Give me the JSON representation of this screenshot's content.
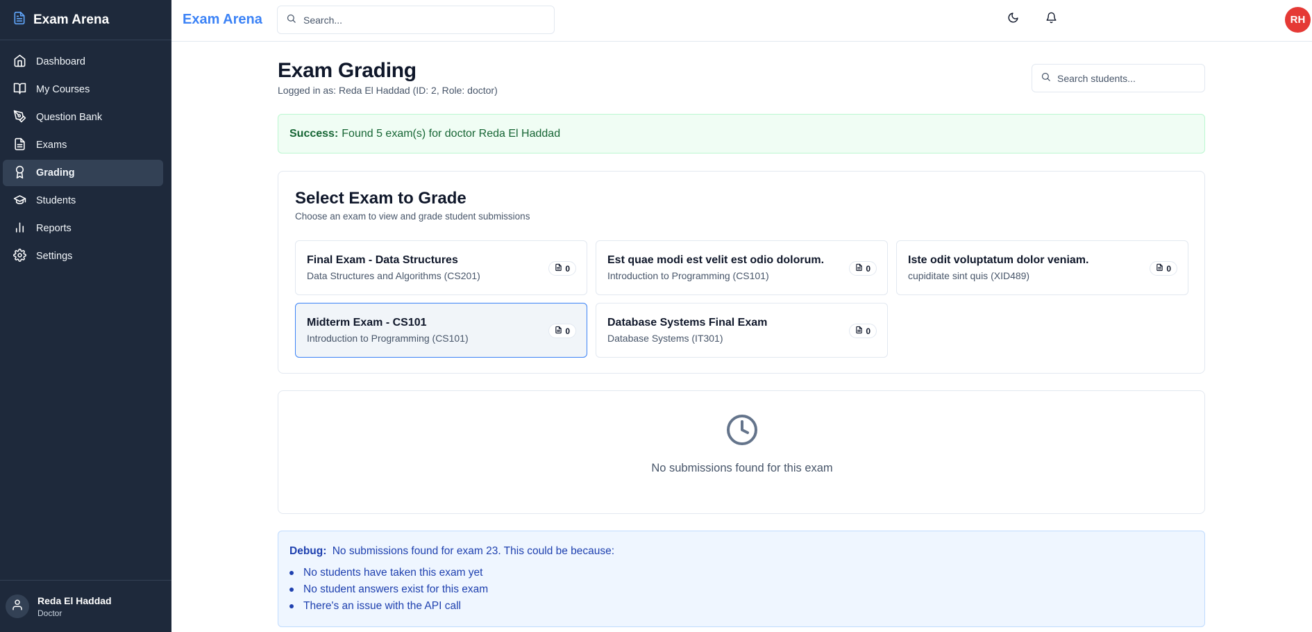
{
  "sidebar": {
    "brand": "Exam Arena",
    "items": [
      {
        "label": "Dashboard",
        "icon": "home-icon"
      },
      {
        "label": "My Courses",
        "icon": "book-icon"
      },
      {
        "label": "Question Bank",
        "icon": "pen-tool-icon"
      },
      {
        "label": "Exams",
        "icon": "file-text-icon"
      },
      {
        "label": "Grading",
        "icon": "award-icon",
        "active": true
      },
      {
        "label": "Students",
        "icon": "graduation-cap-icon"
      },
      {
        "label": "Reports",
        "icon": "bar-chart-icon"
      },
      {
        "label": "Settings",
        "icon": "gear-icon"
      }
    ],
    "user": {
      "name": "Reda El Haddad",
      "role": "Doctor"
    }
  },
  "topbar": {
    "title": "Exam Arena",
    "search_placeholder": "Search...",
    "avatar_initials": "RH"
  },
  "page": {
    "title": "Exam Grading",
    "subtitle": "Logged in as: Reda El Haddad (ID: 2, Role: doctor)",
    "student_search_placeholder": "Search students..."
  },
  "alert": {
    "label": "Success:",
    "message": "Found 5 exam(s) for doctor Reda El Haddad"
  },
  "select_card": {
    "title": "Select Exam to Grade",
    "subtitle": "Choose an exam to view and grade student submissions",
    "exams": [
      {
        "title": "Final Exam - Data Structures",
        "course": "Data Structures and Algorithms (CS201)",
        "count": "0"
      },
      {
        "title": "Est quae modi est velit est odio dolorum.",
        "course": "Introduction to Programming (CS101)",
        "count": "0"
      },
      {
        "title": "Iste odit voluptatum dolor veniam.",
        "course": "cupiditate sint quis (XID489)",
        "count": "0"
      },
      {
        "title": "Midterm Exam - CS101",
        "course": "Introduction to Programming (CS101)",
        "count": "0",
        "selected": true
      },
      {
        "title": "Database Systems Final Exam",
        "course": "Database Systems (IT301)",
        "count": "0"
      }
    ]
  },
  "empty_state": {
    "icon": "clock-icon",
    "message": "No submissions found for this exam"
  },
  "debug": {
    "label": "Debug:",
    "message": "No submissions found for exam 23. This could be because:",
    "reasons": [
      "No students have taken this exam yet",
      "No student answers exist for this exam",
      "There's an issue with the API call"
    ]
  },
  "colors": {
    "sidebar_bg": "#1e293b",
    "accent": "#3b82f6",
    "avatar": "#e53935",
    "success_bg": "#f0fdf4",
    "debug_bg": "#eff6ff"
  }
}
